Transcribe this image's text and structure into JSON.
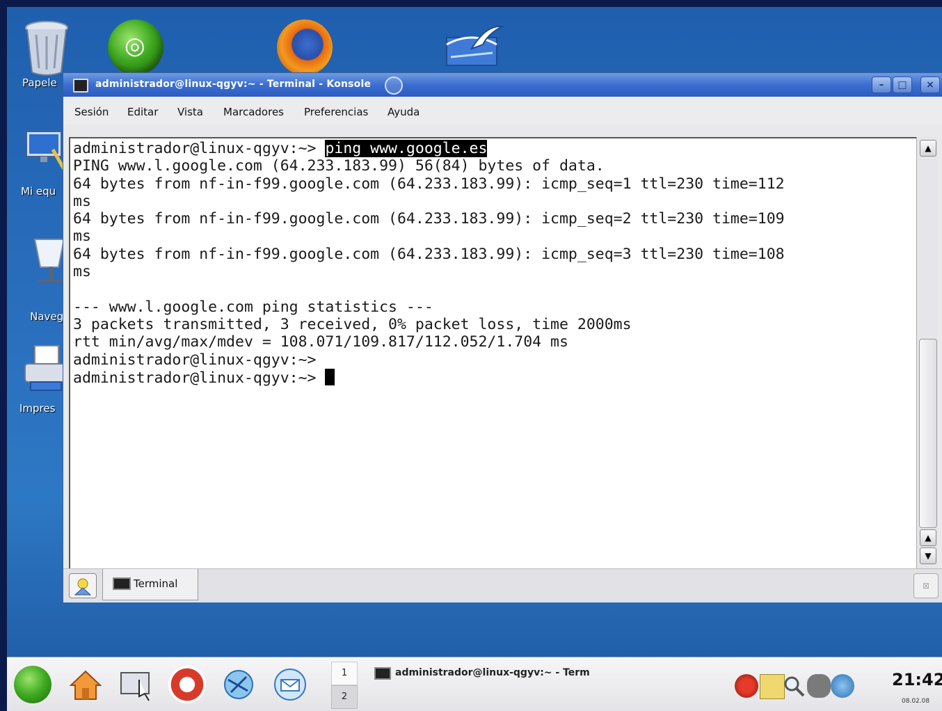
{
  "desktop": {
    "icons": [
      {
        "label": "Papele"
      },
      {
        "label": "Mi equ"
      },
      {
        "label": "Navega\npor la r"
      },
      {
        "label": "Impres"
      }
    ]
  },
  "window": {
    "title": "administrador@linux-qgyv:~ - Terminal - Konsole",
    "buttons": {
      "minimize": "–",
      "maximize": "□",
      "close": "×"
    }
  },
  "menu": [
    "Sesión",
    "Editar",
    "Vista",
    "Marcadores",
    "Preferencias",
    "Ayuda"
  ],
  "terminal": {
    "prompt": "administrador@linux-qgyv:~> ",
    "command": "ping www.google.es",
    "lines": [
      "PING www.l.google.com (64.233.183.99) 56(84) bytes of data.",
      "64 bytes from nf-in-f99.google.com (64.233.183.99): icmp_seq=1 ttl=230 time=112",
      "ms",
      "64 bytes from nf-in-f99.google.com (64.233.183.99): icmp_seq=2 ttl=230 time=109",
      "ms",
      "64 bytes from nf-in-f99.google.com (64.233.183.99): icmp_seq=3 ttl=230 time=108",
      "ms",
      "",
      "--- www.l.google.com ping statistics ---",
      "3 packets transmitted, 3 received, 0% packet loss, time 2000ms",
      "rtt min/avg/max/mdev = 108.071/109.817/112.052/1.704 ms",
      "administrador@linux-qgyv:~>",
      "administrador@linux-qgyv:~> "
    ]
  },
  "tabs": [
    {
      "label": "Terminal"
    }
  ],
  "taskbar": {
    "pager": [
      "1",
      "2"
    ],
    "task_label": "administrador@linux-qgyv:~ - Term",
    "clock": "21:42",
    "date": "08.02.08"
  }
}
